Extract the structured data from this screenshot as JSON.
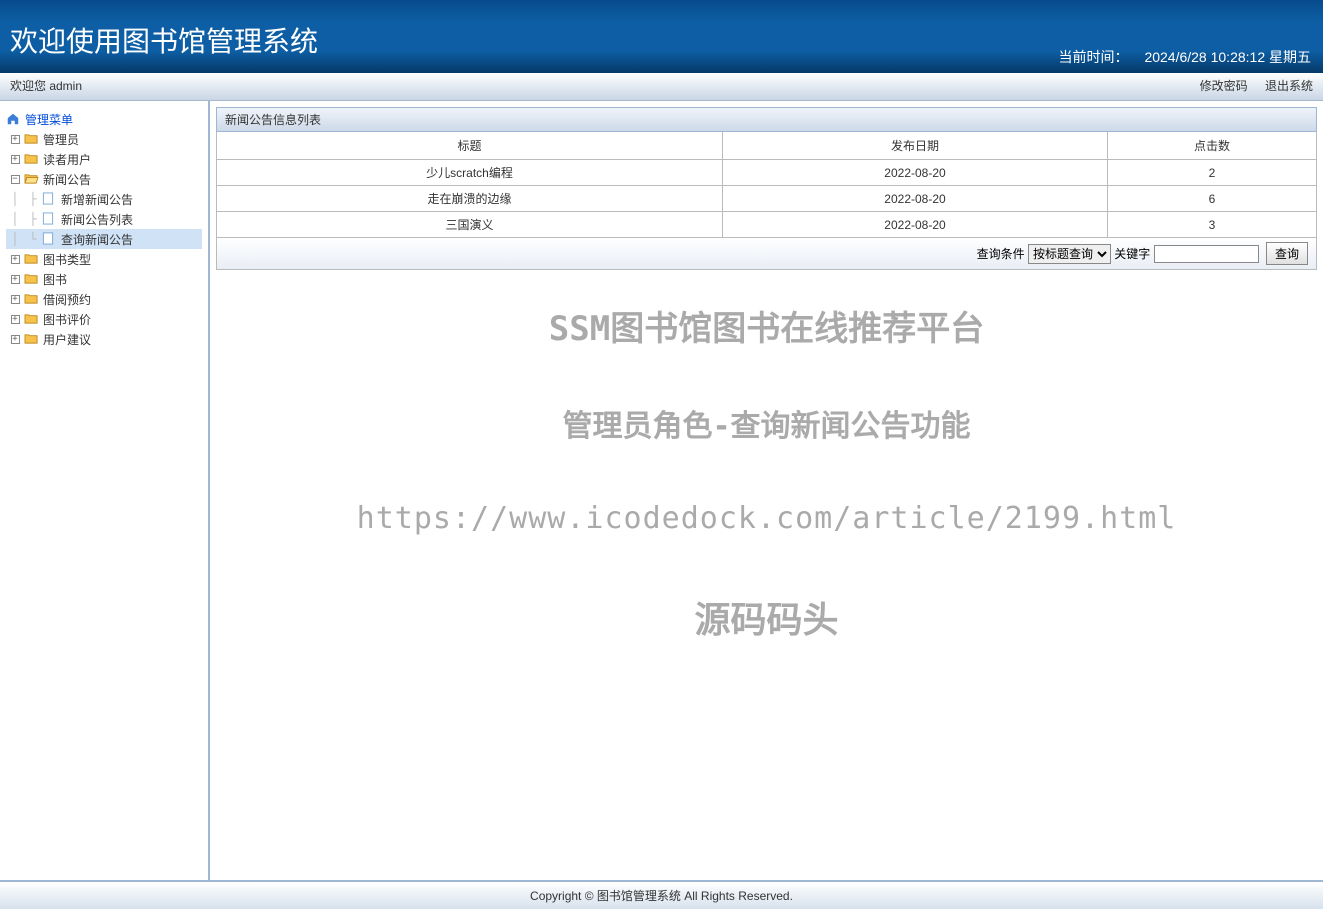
{
  "header": {
    "title": "欢迎使用图书馆管理系统",
    "time_label": "当前时间：",
    "time_value": "2024/6/28 10:28:12 星期五"
  },
  "topbar": {
    "welcome": "欢迎您 admin",
    "change_pwd": "修改密码",
    "logout": "退出系统"
  },
  "sidebar": {
    "root": "管理菜单",
    "items": [
      {
        "label": "管理员",
        "expanded": false
      },
      {
        "label": "读者用户",
        "expanded": false
      },
      {
        "label": "新闻公告",
        "expanded": true,
        "children": [
          {
            "label": "新增新闻公告"
          },
          {
            "label": "新闻公告列表"
          },
          {
            "label": "查询新闻公告",
            "selected": true
          }
        ]
      },
      {
        "label": "图书类型",
        "expanded": false
      },
      {
        "label": "图书",
        "expanded": false
      },
      {
        "label": "借阅预约",
        "expanded": false
      },
      {
        "label": "图书评价",
        "expanded": false
      },
      {
        "label": "用户建议",
        "expanded": false
      }
    ]
  },
  "panel": {
    "title": "新闻公告信息列表",
    "columns": [
      "标题",
      "发布日期",
      "点击数"
    ],
    "rows": [
      {
        "title": "少儿scratch编程",
        "date": "2022-08-20",
        "clicks": "2"
      },
      {
        "title": "走在崩溃的边缘",
        "date": "2022-08-20",
        "clicks": "6"
      },
      {
        "title": "三国演义",
        "date": "2022-08-20",
        "clicks": "3"
      }
    ],
    "search": {
      "cond_label": "查询条件",
      "cond_value": "按标题查询",
      "keyword_label": "关键字",
      "keyword_value": "",
      "button": "查询"
    }
  },
  "watermark": {
    "line1": "SSM图书馆图书在线推荐平台",
    "line2": "管理员角色-查询新闻公告功能",
    "line3": "https://www.icodedock.com/article/2199.html",
    "line4": "源码码头"
  },
  "footer": "Copyright © 图书馆管理系统 All Rights Reserved."
}
